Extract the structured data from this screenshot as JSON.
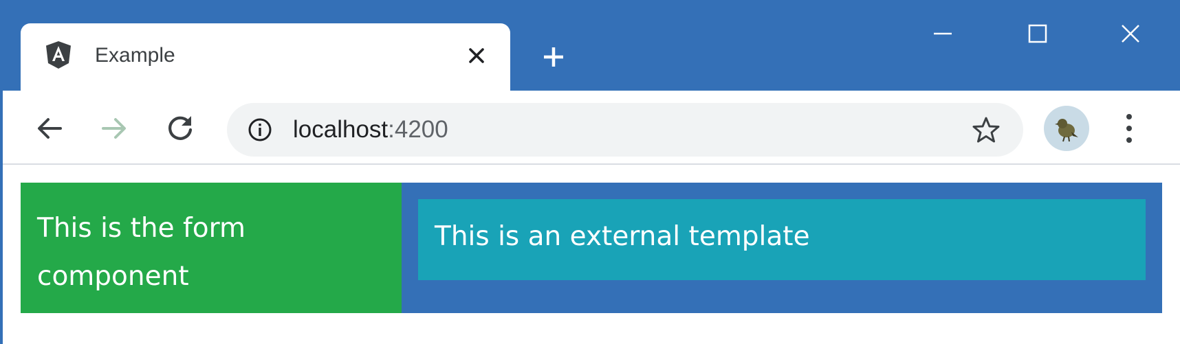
{
  "browser": {
    "tab": {
      "title": "Example",
      "favicon": "angular-logo-icon"
    },
    "address_bar": {
      "host": "localhost",
      "port": ":4200"
    },
    "icons": {
      "close_tab": "close-icon",
      "new_tab": "plus-icon",
      "minimize": "minimize-icon",
      "maximize": "maximize-icon",
      "close_window": "close-icon",
      "back": "arrow-left-icon",
      "forward": "arrow-right-icon",
      "reload": "reload-icon",
      "site_info": "info-icon",
      "bookmark": "star-icon",
      "profile": "avatar",
      "menu": "more-vert-icon"
    }
  },
  "page": {
    "form_component": {
      "text": "This is the form component"
    },
    "external_template": {
      "text": "This is an external template"
    }
  },
  "colors": {
    "chrome": "#3470b7",
    "form_panel": "#24a949",
    "outer_panel": "#3470b7",
    "template_panel": "#19a3b7"
  }
}
